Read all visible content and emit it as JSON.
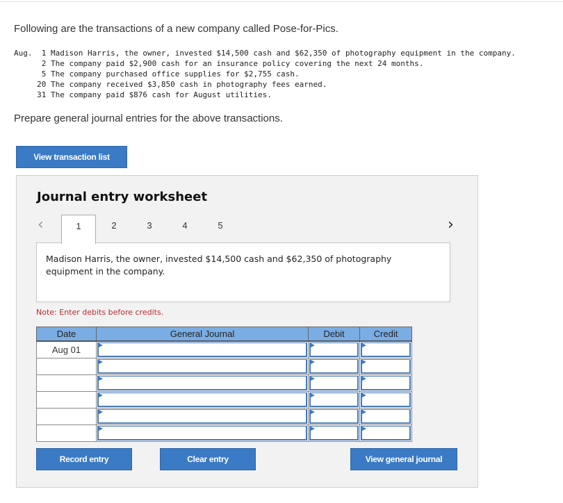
{
  "intro": "Following are the transactions of a new company called Pose-for-Pics.",
  "transactions_block": "Aug.  1 Madison Harris, the owner, invested $14,500 cash and $62,350 of photography equipment in the company.\n      2 The company paid $2,900 cash for an insurance policy covering the next 24 months.\n      5 The company purchased office supplies for $2,755 cash.\n     20 The company received $3,850 cash in photography fees earned.\n     31 The company paid $876 cash for August utilities.",
  "instruction": "Prepare general journal entries for the above transactions.",
  "view_transaction_list": "View transaction list",
  "worksheet": {
    "title": "Journal entry worksheet",
    "prev": "‹",
    "next": "›",
    "tabs": [
      "1",
      "2",
      "3",
      "4",
      "5"
    ],
    "description": "Madison Harris, the owner, invested $14,500 cash and $62,350 of photography equipment in the company.",
    "note": "Note: Enter debits before credits.",
    "columns": [
      "Date",
      "General Journal",
      "Debit",
      "Credit"
    ],
    "rows": [
      {
        "date": "Aug 01"
      },
      {
        "date": ""
      },
      {
        "date": ""
      },
      {
        "date": ""
      },
      {
        "date": ""
      },
      {
        "date": ""
      }
    ],
    "record": "Record entry",
    "clear": "Clear entry",
    "view_gj": "View general journal"
  }
}
